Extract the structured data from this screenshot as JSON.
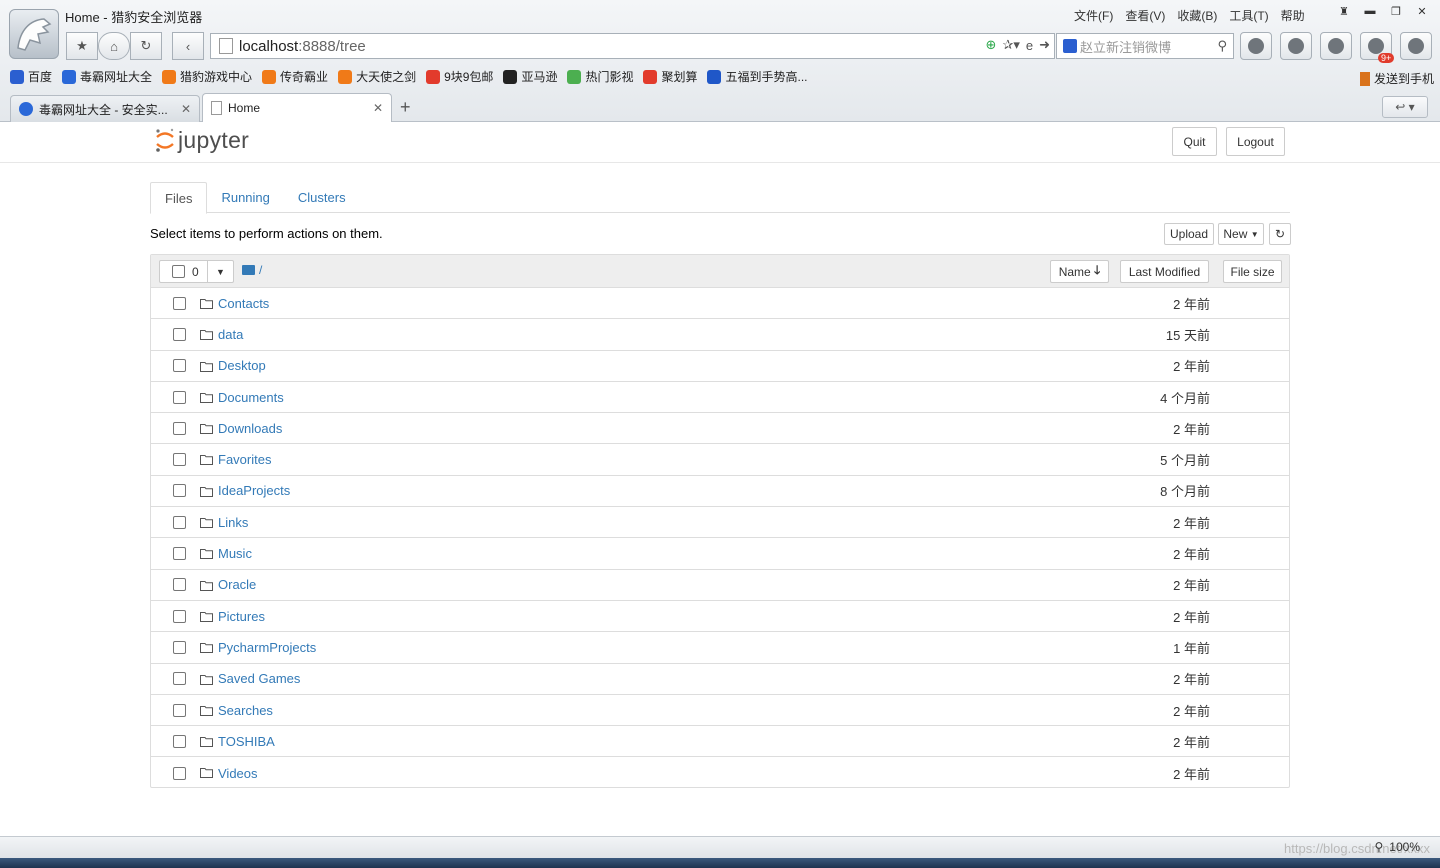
{
  "browser": {
    "window_title": "Home - 猎豹安全浏览器",
    "menu": [
      "文件(F)",
      "查看(V)",
      "收藏(B)",
      "工具(T)",
      "帮助"
    ],
    "url_host": "localhost",
    "url_rest": ":8888/tree",
    "search_placeholder": "赵立新注销微博",
    "notification_badge": "9+",
    "bookmarks": [
      {
        "label": "百度",
        "color": "#2b5fd0"
      },
      {
        "label": "毒霸网址大全",
        "color": "#2a68d8"
      },
      {
        "label": "猎豹游戏中心",
        "color": "#f07a18"
      },
      {
        "label": "传奇霸业",
        "color": "#f07a18"
      },
      {
        "label": "大天使之剑",
        "color": "#f07a18"
      },
      {
        "label": "9块9包邮",
        "color": "#e23b2c"
      },
      {
        "label": "亚马逊",
        "color": "#222222"
      },
      {
        "label": "热门影视",
        "color": "#4caf50"
      },
      {
        "label": "聚划算",
        "color": "#e23b2c"
      },
      {
        "label": "五福到手势高...",
        "color": "#1f57c8"
      }
    ],
    "send_to_phone": "发送到手机",
    "tabs": [
      {
        "label": "毒霸网址大全 - 安全实...",
        "icon": "k-icon"
      },
      {
        "label": "Home",
        "icon": "page-icon"
      }
    ],
    "zoom": "100%",
    "watermark": "https://blog.csdn.net/xxxx"
  },
  "jupyter": {
    "brand": "jupyter",
    "quit_label": "Quit",
    "logout_label": "Logout",
    "tabs": [
      "Files",
      "Running",
      "Clusters"
    ],
    "hint": "Select items to perform actions on them.",
    "upload_label": "Upload",
    "new_label": "New",
    "selected_count": "0",
    "breadcrumb": "/",
    "col_name": "Name",
    "col_modified": "Last Modified",
    "col_size": "File size",
    "files": [
      {
        "name": "Contacts",
        "modified": "2 年前"
      },
      {
        "name": "data",
        "modified": "15 天前"
      },
      {
        "name": "Desktop",
        "modified": "2 年前"
      },
      {
        "name": "Documents",
        "modified": "4 个月前"
      },
      {
        "name": "Downloads",
        "modified": "2 年前"
      },
      {
        "name": "Favorites",
        "modified": "5 个月前"
      },
      {
        "name": "IdeaProjects",
        "modified": "8 个月前"
      },
      {
        "name": "Links",
        "modified": "2 年前"
      },
      {
        "name": "Music",
        "modified": "2 年前"
      },
      {
        "name": "Oracle",
        "modified": "2 年前"
      },
      {
        "name": "Pictures",
        "modified": "2 年前"
      },
      {
        "name": "PycharmProjects",
        "modified": "1 年前"
      },
      {
        "name": "Saved Games",
        "modified": "2 年前"
      },
      {
        "name": "Searches",
        "modified": "2 年前"
      },
      {
        "name": "TOSHIBA",
        "modified": "2 年前"
      },
      {
        "name": "Videos",
        "modified": "2 年前"
      }
    ]
  },
  "colors": {
    "link": "#337ab7",
    "jupyter_orange": "#f37726"
  }
}
